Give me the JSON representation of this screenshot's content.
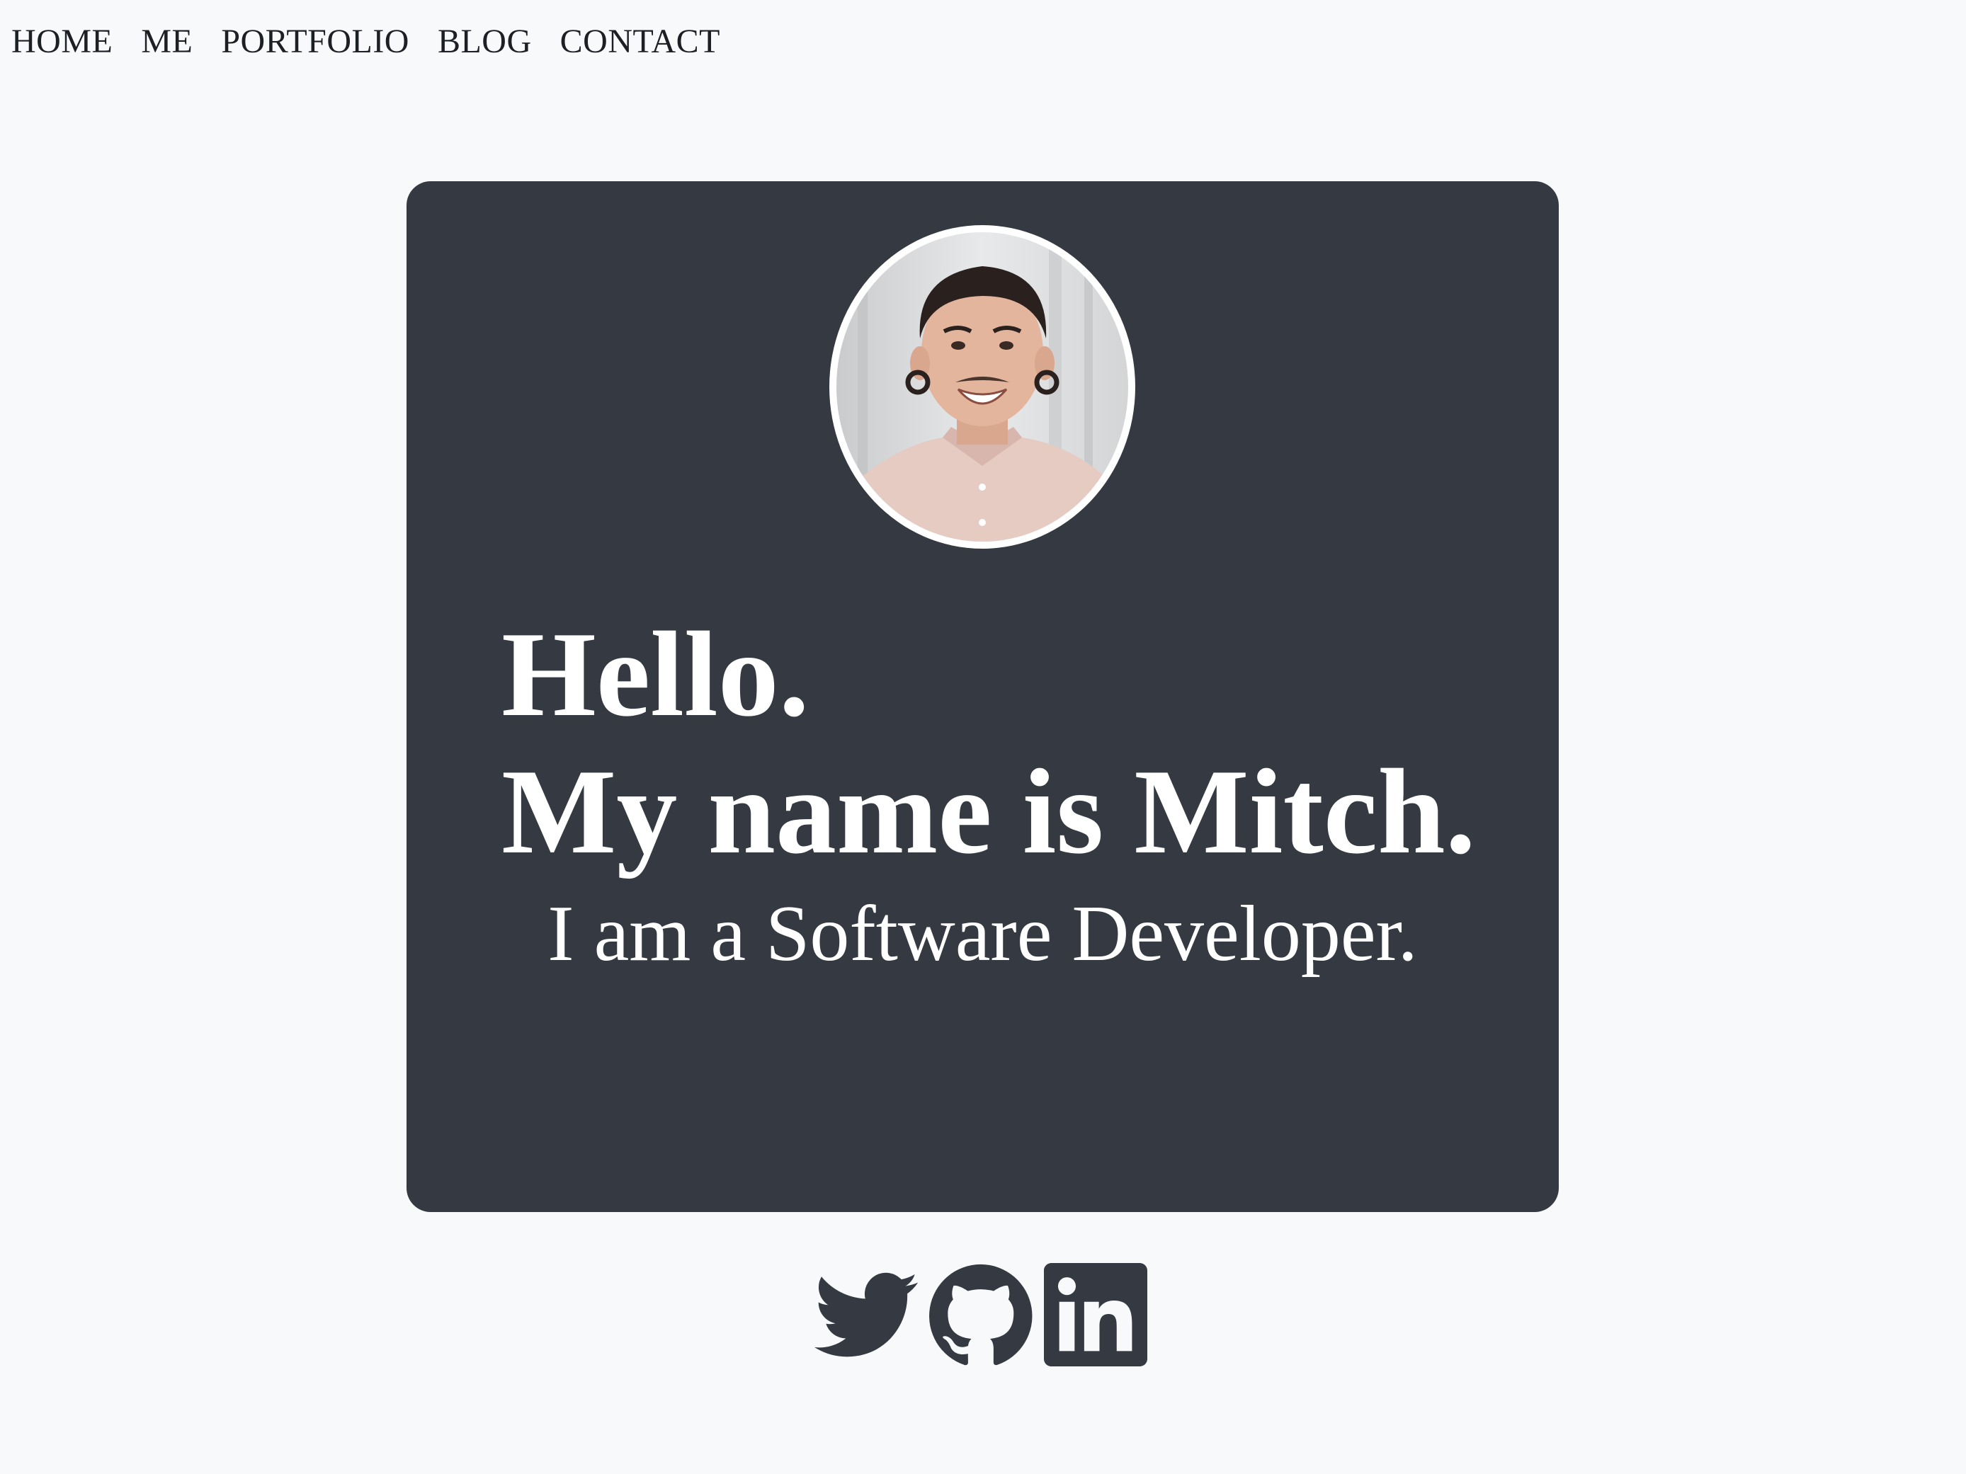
{
  "nav": {
    "items": [
      {
        "label": "HOME"
      },
      {
        "label": "ME"
      },
      {
        "label": "PORTFOLIO"
      },
      {
        "label": "BLOG"
      },
      {
        "label": "CONTACT"
      }
    ]
  },
  "hero": {
    "greeting": "Hello.",
    "name_line": "My name is Mitch.",
    "tagline": "I am a Software Developer."
  },
  "social": {
    "icons": [
      "twitter-icon",
      "github-icon",
      "linkedin-icon"
    ]
  },
  "colors": {
    "page_background": "#f8f9fa",
    "card_background": "#353a42",
    "text_on_card": "#ffffff",
    "icon_color": "#353a42"
  }
}
